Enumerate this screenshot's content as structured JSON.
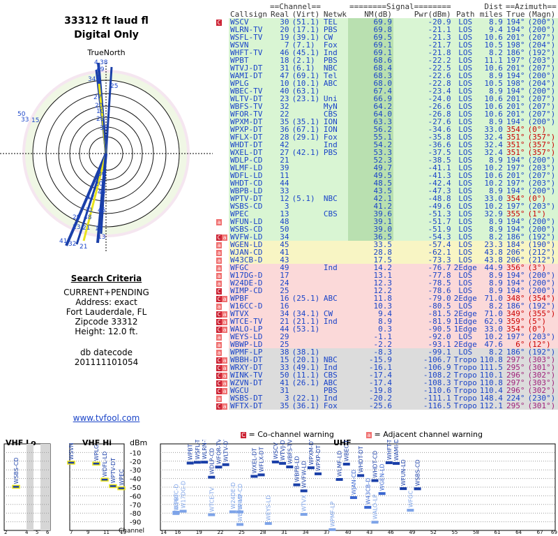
{
  "header": {
    "title": "33312 ft laud fl",
    "subtitle": "Digital Only",
    "true_north": "TrueNorth"
  },
  "search": {
    "heading": "Search Criteria",
    "lines": [
      "CURRENT+PENDING",
      "Address: exact",
      "Fort Lauderdale, FL",
      "Zipcode 33312",
      "Height: 12.0 ft."
    ],
    "datecode_label": "db datecode",
    "datecode": "201111101054",
    "link": "www.tvfool.com"
  },
  "table": {
    "group_headers": [
      "==Channel==",
      "========Signal========",
      "Dist",
      "==Azimuth=="
    ],
    "columns": [
      "Callsign",
      "Real",
      "(Virt)",
      "Netwk",
      "NM(dB)",
      "Pwr(dBm)",
      "Path",
      "miles",
      "True",
      "(Magn)"
    ],
    "rows": [
      {
        "flag": "C",
        "call": "WSCV",
        "real": "30",
        "virt": "(51.1)",
        "net": "TEL",
        "nm": "69.9",
        "pwr": "-20.9",
        "path": "LOS",
        "dist": "8.9",
        "true": "194°",
        "magn": "(200°)",
        "band": "green",
        "azc": ""
      },
      {
        "flag": "",
        "call": "WLRN-TV",
        "real": "20",
        "virt": "(17.1)",
        "net": "PBS",
        "nm": "69.8",
        "pwr": "-21.1",
        "path": "LOS",
        "dist": "9.4",
        "true": "194°",
        "magn": "(200°)",
        "band": "green",
        "azc": ""
      },
      {
        "flag": "",
        "call": "WSFL-TV",
        "real": "19",
        "virt": "(39.1)",
        "net": "CW",
        "nm": "69.5",
        "pwr": "-21.3",
        "path": "LOS",
        "dist": "10.6",
        "true": "201°",
        "magn": "(207°)",
        "band": "green",
        "azc": ""
      },
      {
        "flag": "",
        "call": "WSVN",
        "real": "7",
        "virt": "(7.1)",
        "net": "Fox",
        "nm": "69.1",
        "pwr": "-21.7",
        "path": "LOS",
        "dist": "10.5",
        "true": "198°",
        "magn": "(204°)",
        "band": "green",
        "azc": ""
      },
      {
        "flag": "",
        "call": "WHFT-TV",
        "real": "46",
        "virt": "(45.1)",
        "net": "Ind",
        "nm": "69.1",
        "pwr": "-21.8",
        "path": "LOS",
        "dist": "8.2",
        "true": "186°",
        "magn": "(192°)",
        "band": "green",
        "azc": ""
      },
      {
        "flag": "",
        "call": "WPBT",
        "real": "18",
        "virt": "(2.1)",
        "net": "PBS",
        "nm": "68.6",
        "pwr": "-22.2",
        "path": "LOS",
        "dist": "11.1",
        "true": "197°",
        "magn": "(203°)",
        "band": "green",
        "azc": ""
      },
      {
        "flag": "",
        "call": "WTVJ-DT",
        "real": "31",
        "virt": "(6.1)",
        "net": "NBC",
        "nm": "68.4",
        "pwr": "-22.5",
        "path": "LOS",
        "dist": "10.6",
        "true": "201°",
        "magn": "(207°)",
        "band": "green",
        "azc": ""
      },
      {
        "flag": "",
        "call": "WAMI-DT",
        "real": "47",
        "virt": "(69.1)",
        "net": "Tel",
        "nm": "68.3",
        "pwr": "-22.6",
        "path": "LOS",
        "dist": "8.9",
        "true": "194°",
        "magn": "(200°)",
        "band": "green",
        "azc": ""
      },
      {
        "flag": "",
        "call": "WPLG",
        "real": "10",
        "virt": "(10.1)",
        "net": "ABC",
        "nm": "68.0",
        "pwr": "-22.8",
        "path": "LOS",
        "dist": "10.5",
        "true": "198°",
        "magn": "(204°)",
        "band": "green",
        "azc": ""
      },
      {
        "flag": "",
        "call": "WBEC-TV",
        "real": "40",
        "virt": "(63.1)",
        "net": "",
        "nm": "67.4",
        "pwr": "-23.4",
        "path": "LOS",
        "dist": "8.9",
        "true": "194°",
        "magn": "(200°)",
        "band": "green",
        "azc": ""
      },
      {
        "flag": "",
        "call": "WLTV-DT",
        "real": "23",
        "virt": "(23.1)",
        "net": "Uni",
        "nm": "66.9",
        "pwr": "-24.0",
        "path": "LOS",
        "dist": "10.6",
        "true": "201°",
        "magn": "(207°)",
        "band": "green",
        "azc": ""
      },
      {
        "flag": "",
        "call": "WBFS-TV",
        "real": "32",
        "virt": "",
        "net": "MyN",
        "nm": "64.2",
        "pwr": "-26.6",
        "path": "LOS",
        "dist": "10.6",
        "true": "201°",
        "magn": "(207°)",
        "band": "green",
        "azc": ""
      },
      {
        "flag": "",
        "call": "WFOR-TV",
        "real": "22",
        "virt": "",
        "net": "CBS",
        "nm": "64.0",
        "pwr": "-26.8",
        "path": "LOS",
        "dist": "10.6",
        "true": "201°",
        "magn": "(207°)",
        "band": "green",
        "azc": ""
      },
      {
        "flag": "",
        "call": "WPXM-DT",
        "real": "35",
        "virt": "(35.1)",
        "net": "ION",
        "nm": "63.3",
        "pwr": "-27.6",
        "path": "LOS",
        "dist": "8.9",
        "true": "194°",
        "magn": "(200°)",
        "band": "green",
        "azc": ""
      },
      {
        "flag": "",
        "call": "WPXP-DT",
        "real": "36",
        "virt": "(67.1)",
        "net": "ION",
        "nm": "56.2",
        "pwr": "-34.6",
        "path": "LOS",
        "dist": "33.0",
        "true": "354°",
        "magn": "(0°)",
        "band": "green",
        "azc": "r"
      },
      {
        "flag": "",
        "call": "WFLX-DT",
        "real": "28",
        "virt": "(29.1)",
        "net": "Fox",
        "nm": "55.1",
        "pwr": "-35.8",
        "path": "LOS",
        "dist": "32.4",
        "true": "351°",
        "magn": "(357°)",
        "band": "green",
        "azc": "r"
      },
      {
        "flag": "",
        "call": "WHDT-DT",
        "real": "42",
        "virt": "",
        "net": "Ind",
        "nm": "54.2",
        "pwr": "-36.6",
        "path": "LOS",
        "dist": "32.4",
        "true": "351°",
        "magn": "(357°)",
        "band": "green",
        "azc": "r"
      },
      {
        "flag": "",
        "call": "WXEL-DT",
        "real": "27",
        "virt": "(42.1)",
        "net": "PBS",
        "nm": "53.3",
        "pwr": "-37.5",
        "path": "LOS",
        "dist": "32.4",
        "true": "351°",
        "magn": "(357°)",
        "band": "green",
        "azc": "r"
      },
      {
        "flag": "",
        "call": "WDLP-CD",
        "real": "21",
        "virt": "",
        "net": "",
        "nm": "52.3",
        "pwr": "-38.5",
        "path": "LOS",
        "dist": "8.9",
        "true": "194°",
        "magn": "(200°)",
        "band": "green",
        "azc": ""
      },
      {
        "flag": "",
        "call": "WLMF-LD",
        "real": "39",
        "virt": "",
        "net": "",
        "nm": "49.7",
        "pwr": "-41.1",
        "path": "LOS",
        "dist": "10.2",
        "true": "197°",
        "magn": "(203°)",
        "band": "green",
        "azc": ""
      },
      {
        "flag": "",
        "call": "WDFL-LD",
        "real": "11",
        "virt": "",
        "net": "",
        "nm": "49.5",
        "pwr": "-41.3",
        "path": "LOS",
        "dist": "10.6",
        "true": "201°",
        "magn": "(207°)",
        "band": "green",
        "azc": ""
      },
      {
        "flag": "",
        "call": "WHDT-CD",
        "real": "44",
        "virt": "",
        "net": "",
        "nm": "48.5",
        "pwr": "-42.4",
        "path": "LOS",
        "dist": "10.2",
        "true": "197°",
        "magn": "(203°)",
        "band": "green",
        "azc": ""
      },
      {
        "flag": "",
        "call": "WBPB-LD",
        "real": "33",
        "virt": "",
        "net": "",
        "nm": "43.5",
        "pwr": "-47.3",
        "path": "LOS",
        "dist": "8.9",
        "true": "194°",
        "magn": "(200°)",
        "band": "green",
        "azc": ""
      },
      {
        "flag": "",
        "call": "WPTV-DT",
        "real": "12",
        "virt": "(5.1)",
        "net": "NBC",
        "nm": "42.1",
        "pwr": "-48.8",
        "path": "LOS",
        "dist": "33.0",
        "true": "354°",
        "magn": "(0°)",
        "band": "green",
        "azc": "r"
      },
      {
        "flag": "",
        "call": "WSBS-CD",
        "real": "3",
        "virt": "",
        "net": "",
        "nm": "41.2",
        "pwr": "-49.6",
        "path": "LOS",
        "dist": "10.2",
        "true": "197°",
        "magn": "(203°)",
        "band": "green",
        "azc": ""
      },
      {
        "flag": "",
        "call": "WPEC",
        "real": "13",
        "virt": "",
        "net": "CBS",
        "nm": "39.6",
        "pwr": "-51.3",
        "path": "LOS",
        "dist": "32.9",
        "true": "355°",
        "magn": "(1°)",
        "band": "green",
        "azc": "r"
      },
      {
        "flag": "a",
        "call": "WFUN-LD",
        "real": "48",
        "virt": "",
        "net": "",
        "nm": "39.1",
        "pwr": "-51.7",
        "path": "LOS",
        "dist": "8.9",
        "true": "194°",
        "magn": "(200°)",
        "band": "green",
        "azc": ""
      },
      {
        "flag": "",
        "call": "WSBS-CD",
        "real": "50",
        "virt": "",
        "net": "",
        "nm": "39.0",
        "pwr": "-51.9",
        "path": "LOS",
        "dist": "8.9",
        "true": "194°",
        "magn": "(200°)",
        "band": "green",
        "azc": ""
      },
      {
        "flag": "Ca",
        "call": "WVFW-LD",
        "real": "34",
        "virt": "",
        "net": "",
        "nm": "36.5",
        "pwr": "-54.3",
        "path": "LOS",
        "dist": "8.2",
        "true": "186°",
        "magn": "(192°)",
        "band": "green",
        "azc": ""
      },
      {
        "flag": "a",
        "call": "WGEN-LD",
        "real": "45",
        "virt": "",
        "net": "",
        "nm": "33.5",
        "pwr": "-57.4",
        "path": "LOS",
        "dist": "23.3",
        "true": "184°",
        "magn": "(190°)",
        "band": "yellow",
        "azc": ""
      },
      {
        "flag": "a",
        "call": "WJAN-CD",
        "real": "41",
        "virt": "",
        "net": "",
        "nm": "28.8",
        "pwr": "-62.1",
        "path": "LOS",
        "dist": "43.8",
        "true": "206°",
        "magn": "(212°)",
        "band": "yellow",
        "azc": ""
      },
      {
        "flag": "a",
        "call": "W43CB-D",
        "real": "43",
        "virt": "",
        "net": "",
        "nm": "17.5",
        "pwr": "-73.3",
        "path": "LOS",
        "dist": "43.8",
        "true": "206°",
        "magn": "(212°)",
        "band": "yellow",
        "azc": ""
      },
      {
        "flag": "a",
        "call": "WFGC",
        "real": "49",
        "virt": "",
        "net": "Ind",
        "nm": "14.2",
        "pwr": "-76.7",
        "path": "2Edge",
        "dist": "44.9",
        "true": "356°",
        "magn": "(3°)",
        "band": "pink",
        "azc": "r"
      },
      {
        "flag": "a",
        "call": "W17DG-D",
        "real": "17",
        "virt": "",
        "net": "",
        "nm": "13.1",
        "pwr": "-77.8",
        "path": "LOS",
        "dist": "8.9",
        "true": "194°",
        "magn": "(200°)",
        "band": "pink",
        "azc": ""
      },
      {
        "flag": "a",
        "call": "W24DE-D",
        "real": "24",
        "virt": "",
        "net": "",
        "nm": "12.3",
        "pwr": "-78.5",
        "path": "LOS",
        "dist": "8.9",
        "true": "194°",
        "magn": "(200°)",
        "band": "pink",
        "azc": ""
      },
      {
        "flag": "C",
        "call": "WIMP-CD",
        "real": "25",
        "virt": "",
        "net": "",
        "nm": "12.2",
        "pwr": "-78.6",
        "path": "LOS",
        "dist": "8.9",
        "true": "194°",
        "magn": "(200°)",
        "band": "pink",
        "azc": ""
      },
      {
        "flag": "Ca",
        "call": "WPBF",
        "real": "16",
        "virt": "(25.1)",
        "net": "ABC",
        "nm": "11.8",
        "pwr": "-79.0",
        "path": "2Edge",
        "dist": "71.0",
        "true": "348°",
        "magn": "(354°)",
        "band": "pink",
        "azc": "r"
      },
      {
        "flag": "a",
        "call": "W16CC-D",
        "real": "16",
        "virt": "",
        "net": "",
        "nm": "10.3",
        "pwr": "-80.5",
        "path": "LOS",
        "dist": "8.2",
        "true": "186°",
        "magn": "(192°)",
        "band": "pink",
        "azc": ""
      },
      {
        "flag": "Ca",
        "call": "WTVX",
        "real": "34",
        "virt": "(34.1)",
        "net": "CW",
        "nm": "9.4",
        "pwr": "-81.5",
        "path": "2Edge",
        "dist": "71.0",
        "true": "349°",
        "magn": "(355°)",
        "band": "pink",
        "azc": "r"
      },
      {
        "flag": "Ca",
        "call": "WTCE-TV",
        "real": "21",
        "virt": "(21.1)",
        "net": "Ind",
        "nm": "8.9",
        "pwr": "-81.9",
        "path": "1Edge",
        "dist": "62.9",
        "true": "359°",
        "magn": "(5°)",
        "band": "pink",
        "azc": "r"
      },
      {
        "flag": "Ca",
        "call": "WALO-LP",
        "real": "44",
        "virt": "(53.1)",
        "net": "",
        "nm": "0.3",
        "pwr": "-90.5",
        "path": "1Edge",
        "dist": "33.0",
        "true": "354°",
        "magn": "(0°)",
        "band": "pink",
        "azc": "r"
      },
      {
        "flag": "a",
        "call": "WEYS-LD",
        "real": "29",
        "virt": "",
        "net": "",
        "nm": "-1.1",
        "pwr": "-92.0",
        "path": "LOS",
        "dist": "10.2",
        "true": "197°",
        "magn": "(203°)",
        "band": "pink",
        "azc": ""
      },
      {
        "flag": "a",
        "call": "WBWP-LD",
        "real": "25",
        "virt": "",
        "net": "",
        "nm": "-2.2",
        "pwr": "-93.1",
        "path": "2Edge",
        "dist": "47.6",
        "true": "6°",
        "magn": "(12°)",
        "band": "pink",
        "azc": "r"
      },
      {
        "flag": "a",
        "call": "WPMF-LP",
        "real": "38",
        "virt": "(38.1)",
        "net": "",
        "nm": "-8.3",
        "pwr": "-99.1",
        "path": "LOS",
        "dist": "8.2",
        "true": "186°",
        "magn": "(192°)",
        "band": "gray",
        "azc": ""
      },
      {
        "flag": "Ca",
        "call": "WBBH-DT",
        "real": "15",
        "virt": "(20.1)",
        "net": "NBC",
        "nm": "-15.9",
        "pwr": "-106.7",
        "path": "Tropo",
        "dist": "110.8",
        "true": "297°",
        "magn": "(303°)",
        "band": "gray",
        "azc": "p"
      },
      {
        "flag": "Ca",
        "call": "WRXY-DT",
        "real": "33",
        "virt": "(49.1)",
        "net": "Ind",
        "nm": "-16.1",
        "pwr": "-106.9",
        "path": "Tropo",
        "dist": "111.5",
        "true": "295°",
        "magn": "(301°)",
        "band": "gray",
        "azc": "p"
      },
      {
        "flag": "Ca",
        "call": "WINK-TV",
        "real": "50",
        "virt": "(11.1)",
        "net": "CBS",
        "nm": "-17.4",
        "pwr": "-108.2",
        "path": "Tropo",
        "dist": "110.1",
        "true": "296°",
        "magn": "(302°)",
        "band": "gray",
        "azc": "p"
      },
      {
        "flag": "Ca",
        "call": "WZVN-DT",
        "real": "41",
        "virt": "(26.1)",
        "net": "ABC",
        "nm": "-17.4",
        "pwr": "-108.3",
        "path": "Tropo",
        "dist": "110.8",
        "true": "297°",
        "magn": "(303°)",
        "band": "gray",
        "azc": "p"
      },
      {
        "flag": "Ca",
        "call": "WGCU",
        "real": "31",
        "virt": "",
        "net": "PBS",
        "nm": "-19.8",
        "pwr": "-110.6",
        "path": "Tropo",
        "dist": "110.4",
        "true": "296°",
        "magn": "(302°)",
        "band": "gray",
        "azc": "p"
      },
      {
        "flag": "a",
        "call": "WSBS-DT",
        "real": "3",
        "virt": "(22.1)",
        "net": "Ind",
        "nm": "-20.2",
        "pwr": "-111.1",
        "path": "Tropo",
        "dist": "148.4",
        "true": "224°",
        "magn": "(230°)",
        "band": "gray",
        "azc": ""
      },
      {
        "flag": "Ca",
        "call": "WFTX-DT",
        "real": "35",
        "virt": "(36.1)",
        "net": "Fox",
        "nm": "-25.6",
        "pwr": "-116.5",
        "path": "Tropo",
        "dist": "112.1",
        "true": "295°",
        "magn": "(301°)",
        "band": "gray",
        "azc": "p"
      }
    ]
  },
  "legend": {
    "cochannel_glyph": "C",
    "cochannel_text": "= Co-channel warning",
    "adjacent_glyph": "a",
    "adjacent_text": "= Adjacent channel warning"
  },
  "spectrum": {
    "vhf_lo": "VHF Lo",
    "vhf_hi": "VHF Hi",
    "uhf": "UHF",
    "y_unit": "dBm",
    "y_ticks": [
      "-10",
      "-20",
      "-30",
      "-40",
      "-50",
      "-60",
      "-70",
      "-80",
      "-90"
    ],
    "x_label": "Channel",
    "vhf_lo_ticks": [
      "2",
      "4",
      "5",
      "6"
    ],
    "vhf_hi_ticks": [
      "7",
      "9",
      "11",
      "13"
    ],
    "uhf_ticks": [
      "14",
      "16",
      "19",
      "22",
      "25",
      "28",
      "31",
      "34",
      "37",
      "40",
      "43",
      "46",
      "49",
      "52",
      "55",
      "58",
      "61",
      "64",
      "67",
      "69"
    ]
  },
  "polar": {
    "ring_labels": [
      "4",
      "38",
      "49",
      "34",
      "25",
      "4",
      "27",
      "20",
      "10",
      "50",
      "33",
      "15",
      "28",
      "36",
      "30",
      "20",
      "45",
      "31",
      "48",
      "21",
      "12",
      "13",
      "41",
      "32",
      "23",
      "29",
      "47"
    ]
  },
  "colors": {
    "green": "#d9f5d3",
    "yellow": "#f8f5c4",
    "pink": "#fbd9d9",
    "gray": "#dcdcdc",
    "link": "#1a44c8",
    "nm_col": "#b9e0b0"
  }
}
